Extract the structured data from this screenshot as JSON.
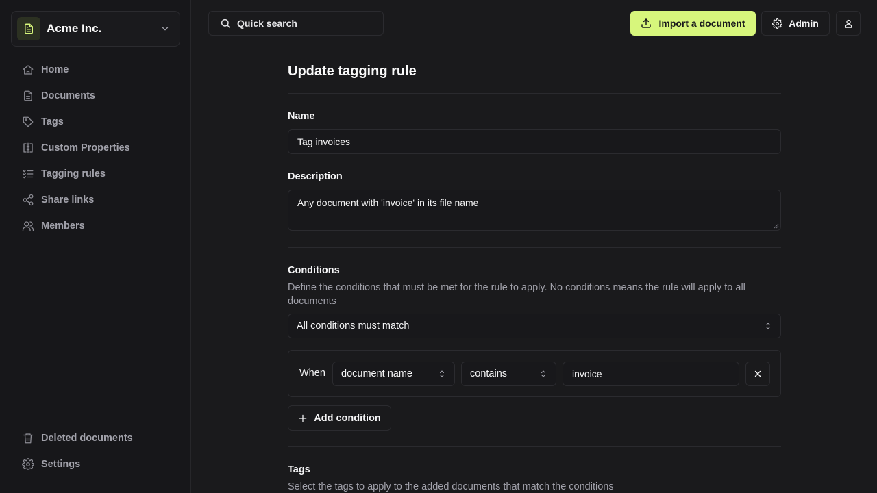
{
  "colors": {
    "background": "#1a1a1c",
    "sidebar": "#17171a",
    "accent": "#d7f67c",
    "text": "#f4f4f5",
    "muted": "#a1a1aa",
    "border": "#2b2b2f"
  },
  "org": {
    "name": "Acme Inc.",
    "logo_icon": "file-text-icon"
  },
  "nav": {
    "items": [
      {
        "label": "Home",
        "icon": "home-icon"
      },
      {
        "label": "Documents",
        "icon": "file-icon"
      },
      {
        "label": "Tags",
        "icon": "tag-icon"
      },
      {
        "label": "Custom Properties",
        "icon": "properties-icon"
      },
      {
        "label": "Tagging rules",
        "icon": "list-check-icon"
      },
      {
        "label": "Share links",
        "icon": "share-icon"
      },
      {
        "label": "Members",
        "icon": "users-icon"
      }
    ],
    "bottom": [
      {
        "label": "Deleted documents",
        "icon": "trash-icon"
      },
      {
        "label": "Settings",
        "icon": "gear-icon"
      }
    ]
  },
  "topbar": {
    "search_label": "Quick search",
    "import_label": "Import a document",
    "admin_label": "Admin"
  },
  "form": {
    "title": "Update tagging rule",
    "name_label": "Name",
    "name_value": "Tag invoices",
    "description_label": "Description",
    "description_value": "Any document with 'invoice' in its file name",
    "conditions_label": "Conditions",
    "conditions_help": "Define the conditions that must be met for the rule to apply. No conditions means the rule will apply to all documents",
    "match_mode": "All conditions must match",
    "condition": {
      "when_label": "When",
      "field": "document name",
      "operator": "contains",
      "value": "invoice"
    },
    "add_condition_label": "Add condition",
    "tags_label": "Tags",
    "tags_help": "Select the tags to apply to the added documents that match the conditions"
  }
}
